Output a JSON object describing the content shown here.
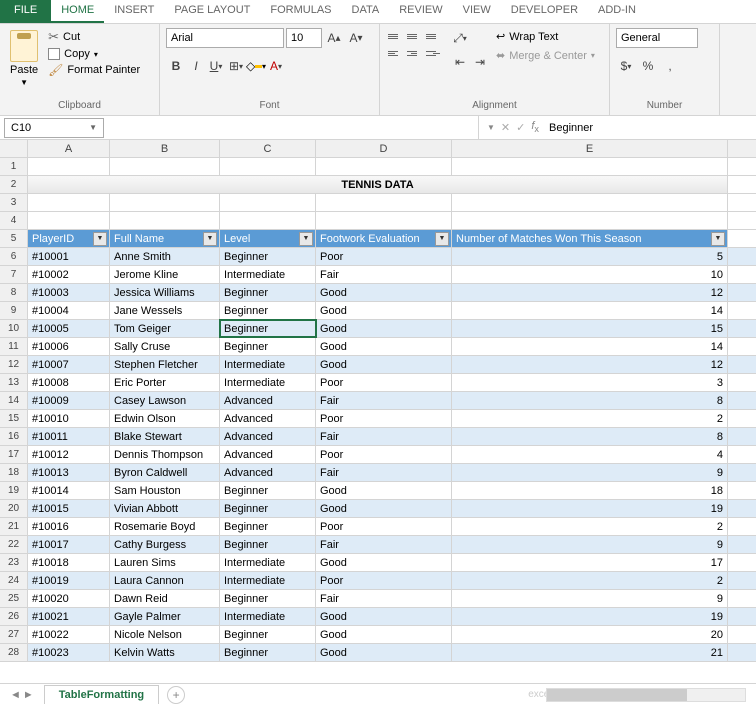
{
  "tabs": [
    "FILE",
    "HOME",
    "INSERT",
    "PAGE LAYOUT",
    "FORMULAS",
    "DATA",
    "REVIEW",
    "VIEW",
    "DEVELOPER",
    "ADD-IN"
  ],
  "active_tab": "HOME",
  "clipboard": {
    "paste": "Paste",
    "cut": "Cut",
    "copy": "Copy",
    "format_painter": "Format Painter",
    "label": "Clipboard"
  },
  "font": {
    "name": "Arial",
    "size": "10",
    "label": "Font"
  },
  "alignment": {
    "wrap": "Wrap Text",
    "merge": "Merge & Center",
    "label": "Alignment"
  },
  "number": {
    "format": "General",
    "label": "Number"
  },
  "name_box": "C10",
  "formula_value": "Beginner",
  "title": "TENNIS DATA",
  "columns": [
    "A",
    "B",
    "C",
    "D",
    "E"
  ],
  "headers": [
    "PlayerID",
    "Full Name",
    "Level",
    "Footwork Evaluation",
    "Number of Matches Won This Season"
  ],
  "rows": [
    {
      "n": 6,
      "id": "#10001",
      "name": "Anne Smith",
      "level": "Beginner",
      "foot": "Poor",
      "wins": "5",
      "band": true
    },
    {
      "n": 7,
      "id": "#10002",
      "name": "Jerome Kline",
      "level": "Intermediate",
      "foot": "Fair",
      "wins": "10",
      "band": false
    },
    {
      "n": 8,
      "id": "#10003",
      "name": "Jessica Williams",
      "level": "Beginner",
      "foot": "Good",
      "wins": "12",
      "band": true
    },
    {
      "n": 9,
      "id": "#10004",
      "name": "Jane Wessels",
      "level": "Beginner",
      "foot": "Good",
      "wins": "14",
      "band": false
    },
    {
      "n": 10,
      "id": "#10005",
      "name": "Tom Geiger",
      "level": "Beginner",
      "foot": "Good",
      "wins": "15",
      "band": true
    },
    {
      "n": 11,
      "id": "#10006",
      "name": "Sally Cruse",
      "level": "Beginner",
      "foot": "Good",
      "wins": "14",
      "band": false
    },
    {
      "n": 12,
      "id": "#10007",
      "name": "Stephen Fletcher",
      "level": "Intermediate",
      "foot": "Good",
      "wins": "12",
      "band": true
    },
    {
      "n": 13,
      "id": "#10008",
      "name": "Eric Porter",
      "level": "Intermediate",
      "foot": "Poor",
      "wins": "3",
      "band": false
    },
    {
      "n": 14,
      "id": "#10009",
      "name": "Casey Lawson",
      "level": "Advanced",
      "foot": "Fair",
      "wins": "8",
      "band": true
    },
    {
      "n": 15,
      "id": "#10010",
      "name": "Edwin Olson",
      "level": "Advanced",
      "foot": "Poor",
      "wins": "2",
      "band": false
    },
    {
      "n": 16,
      "id": "#10011",
      "name": "Blake Stewart",
      "level": "Advanced",
      "foot": "Fair",
      "wins": "8",
      "band": true
    },
    {
      "n": 17,
      "id": "#10012",
      "name": "Dennis Thompson",
      "level": "Advanced",
      "foot": "Poor",
      "wins": "4",
      "band": false
    },
    {
      "n": 18,
      "id": "#10013",
      "name": "Byron Caldwell",
      "level": "Advanced",
      "foot": "Fair",
      "wins": "9",
      "band": true
    },
    {
      "n": 19,
      "id": "#10014",
      "name": "Sam Houston",
      "level": "Beginner",
      "foot": "Good",
      "wins": "18",
      "band": false
    },
    {
      "n": 20,
      "id": "#10015",
      "name": "Vivian Abbott",
      "level": "Beginner",
      "foot": "Good",
      "wins": "19",
      "band": true
    },
    {
      "n": 21,
      "id": "#10016",
      "name": "Rosemarie Boyd",
      "level": "Beginner",
      "foot": "Poor",
      "wins": "2",
      "band": false
    },
    {
      "n": 22,
      "id": "#10017",
      "name": "Cathy Burgess",
      "level": "Beginner",
      "foot": "Fair",
      "wins": "9",
      "band": true
    },
    {
      "n": 23,
      "id": "#10018",
      "name": "Lauren Sims",
      "level": "Intermediate",
      "foot": "Good",
      "wins": "17",
      "band": false
    },
    {
      "n": 24,
      "id": "#10019",
      "name": "Laura Cannon",
      "level": "Intermediate",
      "foot": "Poor",
      "wins": "2",
      "band": true
    },
    {
      "n": 25,
      "id": "#10020",
      "name": "Dawn Reid",
      "level": "Beginner",
      "foot": "Fair",
      "wins": "9",
      "band": false
    },
    {
      "n": 26,
      "id": "#10021",
      "name": "Gayle Palmer",
      "level": "Intermediate",
      "foot": "Good",
      "wins": "19",
      "band": true
    },
    {
      "n": 27,
      "id": "#10022",
      "name": "Nicole Nelson",
      "level": "Beginner",
      "foot": "Good",
      "wins": "20",
      "band": false
    },
    {
      "n": 28,
      "id": "#10023",
      "name": "Kelvin Watts",
      "level": "Beginner",
      "foot": "Good",
      "wins": "21",
      "band": true
    }
  ],
  "sheet_tab": "TableFormatting",
  "watermark": "exceldemy"
}
